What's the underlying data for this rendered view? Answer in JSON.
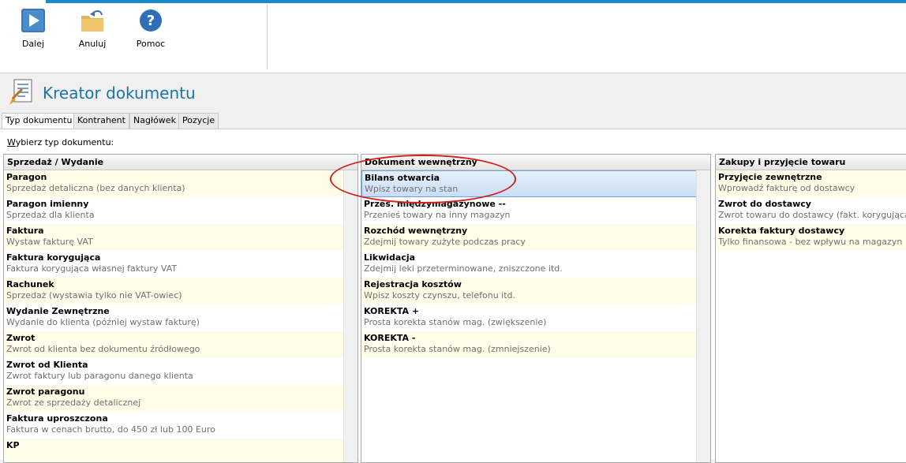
{
  "toolbar": {
    "next_label": "Dalej",
    "cancel_label": "Anuluj",
    "help_label": "Pomoc"
  },
  "header": {
    "title": "Kreator dokumentu"
  },
  "tabs": [
    {
      "label": "Typ dokumentu",
      "active": true
    },
    {
      "label": "Kontrahent",
      "active": false
    },
    {
      "label": "Nagłówek",
      "active": false
    },
    {
      "label": "Pozycje",
      "active": false
    }
  ],
  "prompt": {
    "prefix": "W",
    "rest": "ybierz typ dokumentu:"
  },
  "panels": {
    "sales": {
      "title": "Sprzedaż / Wydanie",
      "items": [
        {
          "title": "Paragon",
          "desc": "Sprzedaż detaliczna (bez danych klienta)"
        },
        {
          "title": "Paragon imienny",
          "desc": "Sprzedaż dla klienta"
        },
        {
          "title": "Faktura",
          "desc": "Wystaw fakturę VAT"
        },
        {
          "title": "Faktura korygująca",
          "desc": "Faktura korygująca własnej faktury VAT"
        },
        {
          "title": "Rachunek",
          "desc": "Sprzedaż (wystawia tylko nie VAT-owiec)"
        },
        {
          "title": "Wydanie Zewnętrzne",
          "desc": "Wydanie do klienta (później wystaw fakturę)"
        },
        {
          "title": "Zwrot",
          "desc": "Zwrot od klienta bez dokumentu źródłowego"
        },
        {
          "title": "Zwrot od  Klienta",
          "desc": "Zwrot faktury lub paragonu danego klienta"
        },
        {
          "title": "Zwrot paragonu",
          "desc": "Zwrot ze sprzedaży detalicznej"
        },
        {
          "title": "Faktura uproszczona",
          "desc": "Faktura w cenach brutto, do 450 zł lub 100 Euro"
        },
        {
          "title": "KP",
          "desc": ""
        }
      ]
    },
    "internal": {
      "title": "Dokument wewnętrzny",
      "items": [
        {
          "title": "Bilans otwarcia",
          "desc": "Wpisz towary na stan"
        },
        {
          "title": "Przes. międzymagazynowe --",
          "desc": "Przenieś towary na inny magazyn"
        },
        {
          "title": "Rozchód wewnętrzny",
          "desc": "Zdejmij towary zużyte podczas pracy"
        },
        {
          "title": "Likwidacja",
          "desc": "Zdejmij leki przeterminowane, zniszczone itd."
        },
        {
          "title": "Rejestracja kosztów",
          "desc": "Wpisz koszty czynszu, telefonu itd."
        },
        {
          "title": "KOREKTA +",
          "desc": "Prosta korekta stanów mag. (zwiększenie)"
        },
        {
          "title": "KOREKTA -",
          "desc": "Prosta korekta stanów mag. (zmniejszenie)"
        }
      ]
    },
    "purchases": {
      "title": "Zakupy i przyjęcie towaru",
      "items": [
        {
          "title": "Przyjęcie zewnętrzne",
          "desc": "Wprowadź fakturę od dostawcy"
        },
        {
          "title": "Zwrot do dostawcy",
          "desc": "Zwrot towaru do dostawcy (fakt. korygująca)"
        },
        {
          "title": "Korekta faktury dostawcy",
          "desc": "Tylko finansowa - bez wpływu na magazyn"
        }
      ]
    }
  },
  "icons": {
    "next": "play-icon",
    "cancel": "folder-undo-icon",
    "help": "help-icon",
    "title": "document-wizard-icon"
  },
  "colors": {
    "accent": "#1e88c8",
    "title": "#1a74a8",
    "row_alt": "#fffde8",
    "selection": "#c9ddf4",
    "annotation": "#d02020"
  }
}
